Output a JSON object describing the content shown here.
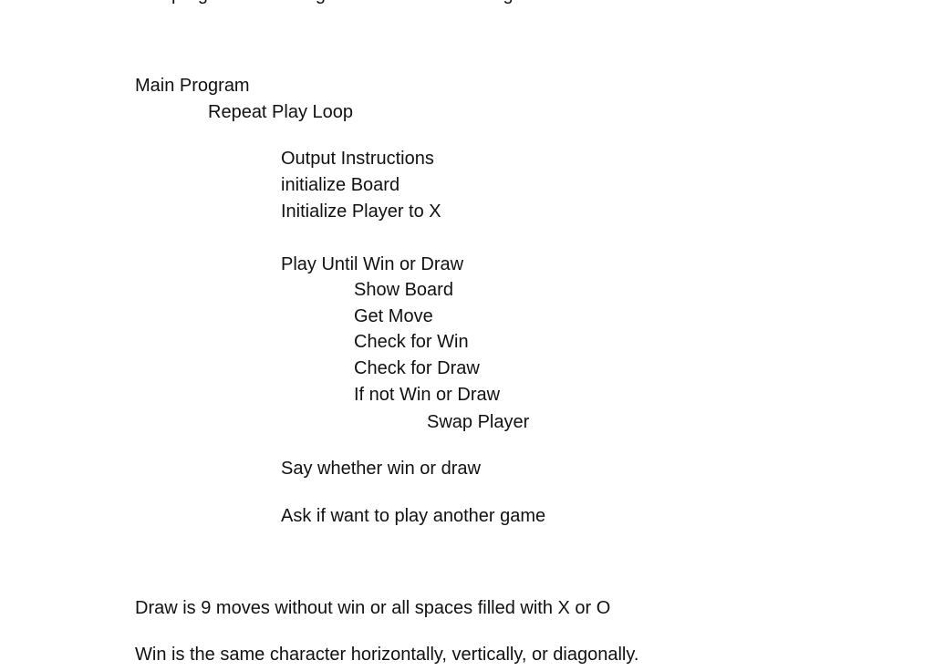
{
  "document": {
    "cut_off_line": "The program will be a game of tic tac toe using",
    "outline": [
      {
        "text": "Main Program",
        "level": 0
      },
      {
        "text": "Repeat Play Loop",
        "level": 1
      },
      {
        "text": "Output Instructions",
        "level": 2
      },
      {
        "text": "initialize Board",
        "level": 2
      },
      {
        "text": "Initialize Player to X",
        "level": 2
      },
      {
        "text": "Play Until Win or Draw",
        "level": 2
      },
      {
        "text": "Show Board",
        "level": 3
      },
      {
        "text": "Get Move",
        "level": 3
      },
      {
        "text": "Check for Win",
        "level": 3
      },
      {
        "text": "Check for Draw",
        "level": 3
      },
      {
        "text": "If not Win or Draw",
        "level": 3
      },
      {
        "text": "Swap Player",
        "level": 4
      },
      {
        "text": "Say whether win or draw",
        "level": 2
      },
      {
        "text": "Ask if want to play another game",
        "level": 2
      }
    ],
    "notes": [
      "Draw is 9 moves without win or all spaces filled with X or O",
      "Win is the same character horizontally, vertically, or diagonally."
    ]
  }
}
